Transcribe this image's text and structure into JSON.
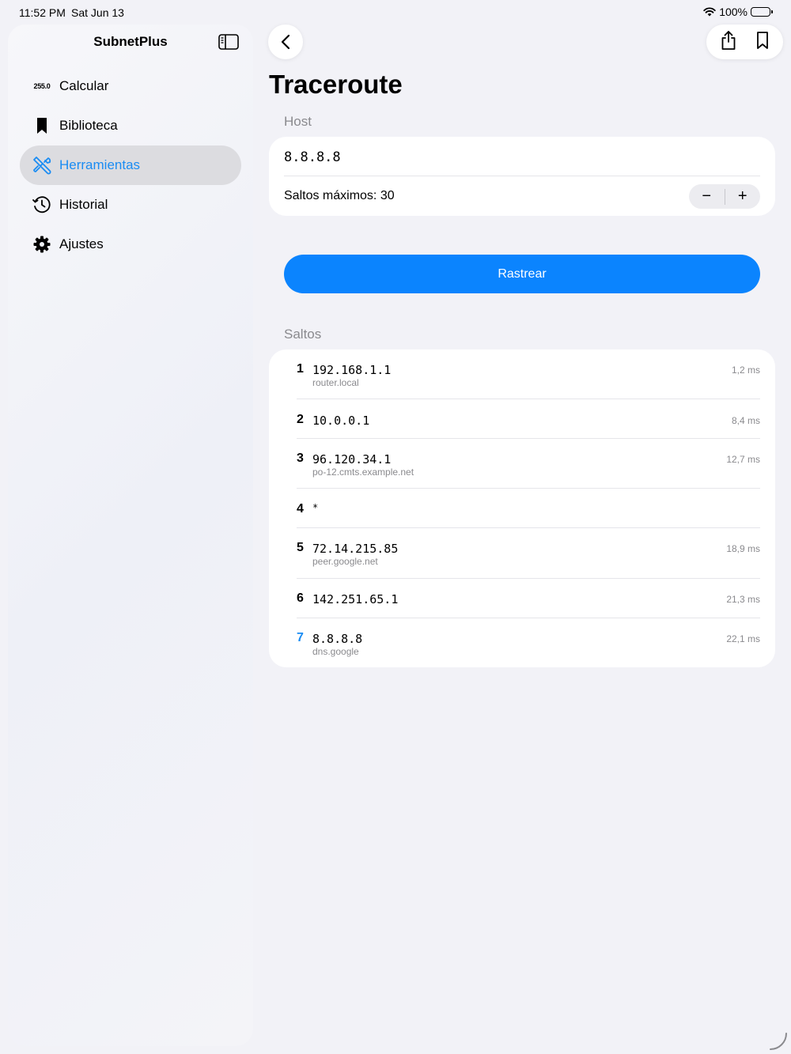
{
  "status": {
    "time": "11:52 PM",
    "date": "Sat Jun 13",
    "battery": "100%"
  },
  "sidebar": {
    "title": "SubnetPlus",
    "items": [
      {
        "label": "Calcular",
        "icon": "255.0"
      },
      {
        "label": "Biblioteca"
      },
      {
        "label": "Herramientas"
      },
      {
        "label": "Historial"
      },
      {
        "label": "Ajustes"
      }
    ]
  },
  "colors": {
    "accent": "#1a8cf3",
    "button": "#0b84fe",
    "background": "#f2f2f7"
  },
  "page": {
    "title": "Traceroute"
  },
  "host": {
    "section": "Host",
    "value": "8.8.8.8",
    "max_hops_label": "Saltos máximos: 30",
    "minus": "−",
    "plus": "+"
  },
  "action": {
    "label": "Rastrear"
  },
  "hops": {
    "section": "Saltos",
    "rows": [
      {
        "num": "1",
        "ip": "192.168.1.1",
        "host": "router.local",
        "ms": "1,2 ms"
      },
      {
        "num": "2",
        "ip": "10.0.0.1",
        "host": "",
        "ms": "8,4 ms"
      },
      {
        "num": "3",
        "ip": "96.120.34.1",
        "host": "po-12.cmts.example.net",
        "ms": "12,7 ms"
      },
      {
        "num": "4",
        "ip": "*",
        "host": "",
        "ms": ""
      },
      {
        "num": "5",
        "ip": "72.14.215.85",
        "host": "peer.google.net",
        "ms": "18,9 ms"
      },
      {
        "num": "6",
        "ip": "142.251.65.1",
        "host": "",
        "ms": "21,3 ms"
      },
      {
        "num": "7",
        "ip": "8.8.8.8",
        "host": "dns.google",
        "ms": "22,1 ms"
      }
    ]
  }
}
